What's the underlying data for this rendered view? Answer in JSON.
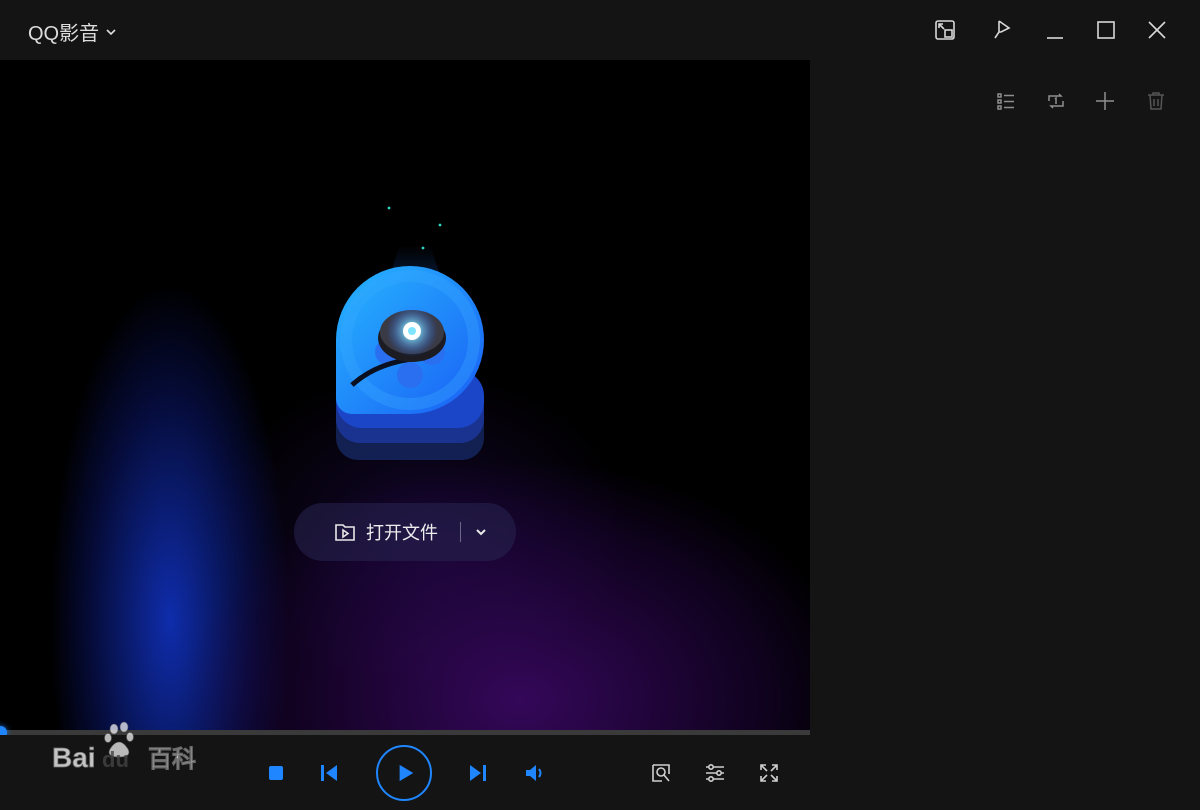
{
  "app": {
    "title": "QQ影音"
  },
  "title_bar": {
    "buttons": [
      "mini-mode-icon",
      "pin-icon",
      "minimize-icon",
      "maximize-icon",
      "close-icon"
    ]
  },
  "playlist_toolbar": {
    "icons": [
      "list-view-icon",
      "loop-icon",
      "add-icon",
      "delete-icon"
    ]
  },
  "open_file": {
    "label": "打开文件"
  },
  "playback": {
    "progress_fraction": 0.0,
    "controls": [
      "stop-icon",
      "previous-icon",
      "play-icon",
      "next-icon",
      "volume-icon"
    ],
    "right_controls": [
      "screenshot-icon",
      "settings-icon",
      "fullscreen-icon"
    ]
  },
  "watermark": {
    "text": "Baidu百科"
  },
  "colors": {
    "accent": "#1f86ff",
    "background": "#141414",
    "video_background": "#000000"
  }
}
